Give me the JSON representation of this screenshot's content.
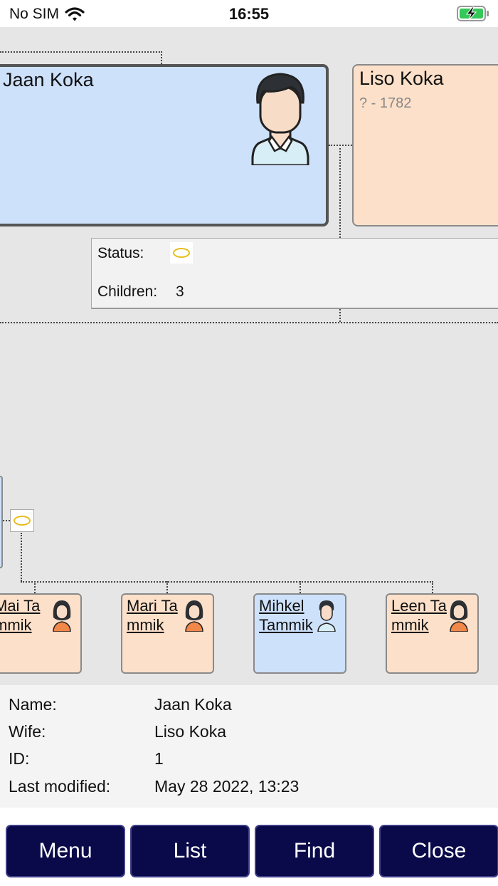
{
  "status_bar": {
    "carrier": "No SIM",
    "time": "16:55"
  },
  "tree": {
    "person": {
      "name": "Jaan Koka",
      "gender": "male"
    },
    "spouse": {
      "name": "Liso Koka",
      "dates": "? - 1782",
      "gender": "female"
    },
    "relation_info": {
      "status_label": "Status:",
      "children_label": "Children:",
      "children_count": "3"
    },
    "children": [
      {
        "name": "Mai Tammik",
        "gender": "female"
      },
      {
        "name": "Mari Tammik",
        "gender": "female"
      },
      {
        "name": "Mihkel Tammik",
        "gender": "male"
      },
      {
        "name": "Leen Tammik",
        "gender": "female"
      }
    ],
    "colors": {
      "male_card": "#cde1fb",
      "female_card": "#fde0c9",
      "ring": "#e6bd1e"
    }
  },
  "details": {
    "name_label": "Name:",
    "name_value": "Jaan Koka",
    "wife_label": "Wife:",
    "wife_value": "Liso Koka",
    "id_label": "ID:",
    "id_value": "1",
    "modified_label": "Last modified:",
    "modified_value": "May 28 2022, 13:23"
  },
  "toolbar": {
    "menu": "Menu",
    "list": "List",
    "find": "Find",
    "close": "Close",
    "button_color": "#0a0a4a"
  }
}
